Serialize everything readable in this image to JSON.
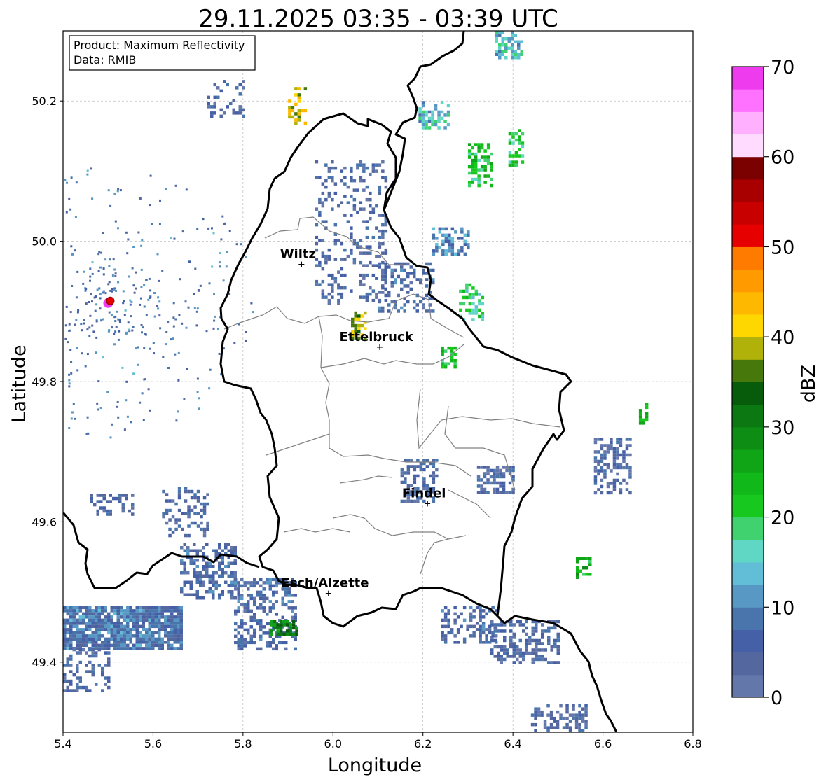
{
  "title": "29.11.2025 03:35 - 03:39 UTC",
  "info_box": {
    "product_line": "Product: Maximum Reflectivity",
    "data_line": "Data: RMIB"
  },
  "axes": {
    "xlabel": "Longitude",
    "ylabel": "Latitude",
    "xlim": [
      5.4,
      6.8
    ],
    "ylim": [
      49.3,
      50.3
    ],
    "xticks": [
      5.4,
      5.6,
      5.8,
      6.0,
      6.2,
      6.4,
      6.6,
      6.8
    ],
    "xtick_labels": [
      "5.4",
      "5.6",
      "5.8",
      "6.0",
      "6.2",
      "6.4",
      "6.6",
      "6.8"
    ],
    "yticks": [
      49.4,
      49.6,
      49.8,
      50.0,
      50.2
    ],
    "ytick_labels": [
      "49.4",
      "49.6",
      "49.8",
      "50.0",
      "50.2"
    ],
    "grid": true
  },
  "colorbar": {
    "label": "dBZ",
    "min": 0,
    "max": 70,
    "tick_values": [
      0,
      10,
      20,
      30,
      40,
      50,
      60,
      70
    ],
    "tick_labels": [
      "0",
      "10",
      "20",
      "30",
      "40",
      "50",
      "60",
      "70"
    ],
    "colors": [
      "#6477aa",
      "#54679f",
      "#4560a6",
      "#4a75ac",
      "#5898c4",
      "#62bdd6",
      "#60d6c4",
      "#3fd26e",
      "#17c91f",
      "#11b81a",
      "#10a417",
      "#0d8d13",
      "#0b7811",
      "#065c0b",
      "#46780b",
      "#b0b20a",
      "#ffd700",
      "#ffb800",
      "#ff9a00",
      "#ff7b00",
      "#e60000",
      "#c80000",
      "#a80000",
      "#7b0000",
      "#ffdcff",
      "#ffb0ff",
      "#ff72ff",
      "#ee3bee"
    ]
  },
  "cities": [
    {
      "name": "Wiltz",
      "lon": 5.93,
      "lat": 49.967
    },
    {
      "name": "Ettelbruck",
      "lon": 6.104,
      "lat": 49.849
    },
    {
      "name": "Findel",
      "lon": 6.21,
      "lat": 49.626
    },
    {
      "name": "Esch/Alzette",
      "lon": 5.99,
      "lat": 49.498
    }
  ],
  "radar_site": {
    "lon": 5.505,
    "lat": 49.915
  },
  "chart_data": {
    "type": "heatmap",
    "title": "29.11.2025 03:35 - 03:39 UTC",
    "xlabel": "Longitude",
    "ylabel": "Latitude",
    "xlim": [
      5.4,
      6.8
    ],
    "ylim": [
      49.3,
      50.3
    ],
    "colorbar_label": "dBZ",
    "value_range": [
      0,
      70
    ],
    "echoes": [
      {
        "lon0": 5.4,
        "lon1": 5.66,
        "lat0": 49.42,
        "lat1": 49.48,
        "dbz": 8,
        "density": 0.85
      },
      {
        "lon0": 5.66,
        "lon1": 5.78,
        "lat0": 49.49,
        "lat1": 49.57,
        "dbz": 6,
        "density": 0.5
      },
      {
        "lon0": 5.78,
        "lon1": 5.92,
        "lat0": 49.42,
        "lat1": 49.52,
        "dbz": 6,
        "density": 0.45
      },
      {
        "lon0": 5.86,
        "lon1": 5.92,
        "lat0": 49.44,
        "lat1": 49.46,
        "dbz": 30,
        "density": 0.8
      },
      {
        "lon0": 5.4,
        "lon1": 5.5,
        "lat0": 49.36,
        "lat1": 49.42,
        "dbz": 5,
        "density": 0.35
      },
      {
        "lon0": 5.62,
        "lon1": 5.72,
        "lat0": 49.58,
        "lat1": 49.65,
        "dbz": 5,
        "density": 0.35
      },
      {
        "lon0": 5.46,
        "lon1": 5.56,
        "lat0": 49.61,
        "lat1": 49.64,
        "dbz": 5,
        "density": 0.3
      },
      {
        "lon0": 5.96,
        "lon1": 6.12,
        "lat0": 49.91,
        "lat1": 50.12,
        "dbz": 5,
        "density": 0.2
      },
      {
        "lon0": 6.1,
        "lon1": 6.22,
        "lat0": 49.9,
        "lat1": 49.97,
        "dbz": 6,
        "density": 0.35
      },
      {
        "lon0": 6.22,
        "lon1": 6.3,
        "lat0": 49.98,
        "lat1": 50.02,
        "dbz": 10,
        "density": 0.5
      },
      {
        "lon0": 6.28,
        "lon1": 6.33,
        "lat0": 49.89,
        "lat1": 49.94,
        "dbz": 18,
        "density": 0.5
      },
      {
        "lon0": 6.3,
        "lon1": 6.35,
        "lat0": 50.08,
        "lat1": 50.14,
        "dbz": 22,
        "density": 0.5
      },
      {
        "lon0": 6.39,
        "lon1": 6.42,
        "lat0": 50.11,
        "lat1": 50.16,
        "dbz": 20,
        "density": 0.5
      },
      {
        "lon0": 6.19,
        "lon1": 6.26,
        "lat0": 50.16,
        "lat1": 50.2,
        "dbz": 14,
        "density": 0.45
      },
      {
        "lon0": 6.36,
        "lon1": 6.42,
        "lat0": 50.26,
        "lat1": 50.3,
        "dbz": 14,
        "density": 0.5
      },
      {
        "lon0": 6.32,
        "lon1": 6.4,
        "lat0": 49.64,
        "lat1": 49.68,
        "dbz": 5,
        "density": 0.55
      },
      {
        "lon0": 6.15,
        "lon1": 6.23,
        "lat0": 49.63,
        "lat1": 49.69,
        "dbz": 5,
        "density": 0.5
      },
      {
        "lon0": 6.58,
        "lon1": 6.66,
        "lat0": 49.64,
        "lat1": 49.72,
        "dbz": 4,
        "density": 0.45
      },
      {
        "lon0": 6.35,
        "lon1": 6.5,
        "lat0": 49.4,
        "lat1": 49.46,
        "dbz": 5,
        "density": 0.4
      },
      {
        "lon0": 6.44,
        "lon1": 6.56,
        "lat0": 49.3,
        "lat1": 49.34,
        "dbz": 5,
        "density": 0.45
      },
      {
        "lon0": 6.24,
        "lon1": 6.36,
        "lat0": 49.43,
        "lat1": 49.48,
        "dbz": 6,
        "density": 0.4
      },
      {
        "lon0": 6.04,
        "lon1": 6.07,
        "lat0": 49.86,
        "lat1": 49.9,
        "dbz": 38,
        "density": 0.6
      },
      {
        "lon0": 6.24,
        "lon1": 6.27,
        "lat0": 49.82,
        "lat1": 49.85,
        "dbz": 22,
        "density": 0.6
      },
      {
        "lon0": 5.72,
        "lon1": 5.8,
        "lat0": 50.18,
        "lat1": 50.23,
        "dbz": 5,
        "density": 0.3
      },
      {
        "lon0": 5.9,
        "lon1": 5.94,
        "lat0": 50.17,
        "lat1": 50.22,
        "dbz": 40,
        "density": 0.35
      },
      {
        "lon0": 6.68,
        "lon1": 6.7,
        "lat0": 49.74,
        "lat1": 49.77,
        "dbz": 24,
        "density": 0.6
      },
      {
        "lon0": 6.54,
        "lon1": 6.57,
        "lat0": 49.52,
        "lat1": 49.55,
        "dbz": 24,
        "density": 0.6
      }
    ]
  }
}
